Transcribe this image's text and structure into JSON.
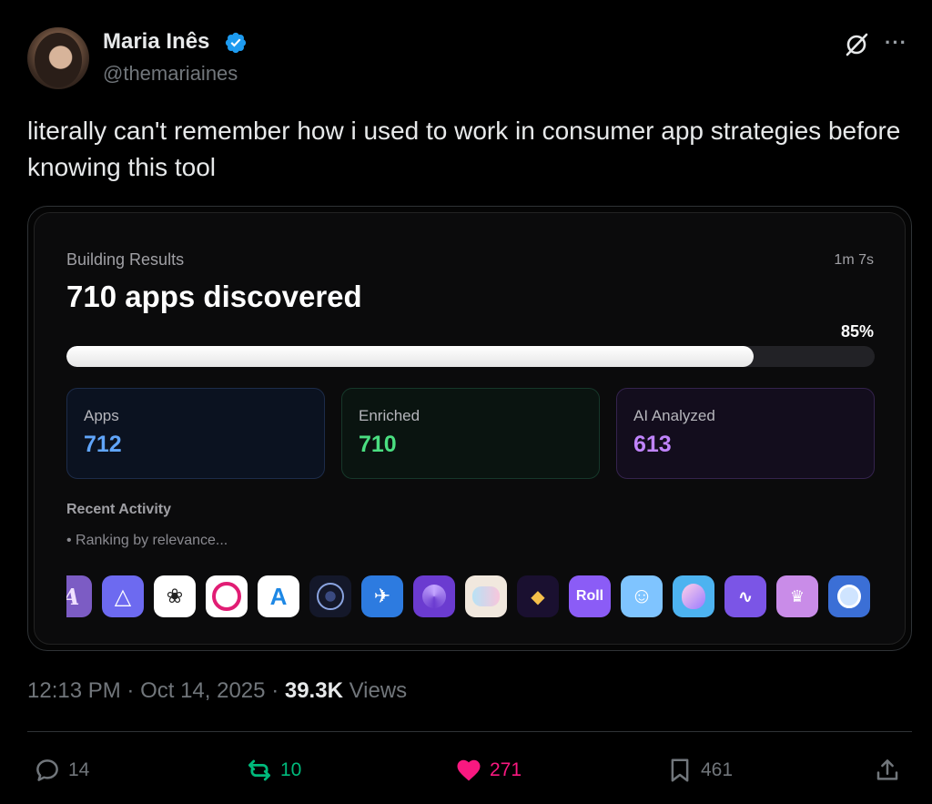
{
  "author": {
    "name": "Maria Inês",
    "handle": "@themariaines",
    "verified": true
  },
  "tweet": {
    "text": "literally can't remember how i used to work in consumer app strategies before knowing this tool"
  },
  "card": {
    "label": "Building Results",
    "elapsed": "1m 7s",
    "headline": "710 apps discovered",
    "progress_percent": "85%",
    "progress_value": 0.85,
    "stats": [
      {
        "label": "Apps",
        "value": "712",
        "color": "#60a5fa"
      },
      {
        "label": "Enriched",
        "value": "710",
        "color": "#4ade80"
      },
      {
        "label": "AI Analyzed",
        "value": "613",
        "color": "#c084fc"
      }
    ],
    "activity_title": "Recent Activity",
    "activity_line": "• Ranking by relevance...",
    "app_icons": [
      {
        "name": "script-a-app-icon",
        "text": "A",
        "bg": "#7c5cc4"
      },
      {
        "name": "triangle-app-icon",
        "text": "",
        "bg": "#6d6af0"
      },
      {
        "name": "meditation-app-icon",
        "text": "",
        "bg": "#ffffff"
      },
      {
        "name": "ring-app-icon",
        "text": "",
        "bg": "#ffffff"
      },
      {
        "name": "app-store-icon",
        "text": "",
        "bg": "#ffffff"
      },
      {
        "name": "flower-of-life-app-icon",
        "text": "",
        "bg": "#14182a"
      },
      {
        "name": "bird-app-icon",
        "text": "",
        "bg": "#2d7be0"
      },
      {
        "name": "swirl-app-icon",
        "text": "",
        "bg": "#6b3bd0"
      },
      {
        "name": "pastel-characters-app-icon",
        "text": "",
        "bg": "#f1e8de"
      },
      {
        "name": "black-cat-app-icon",
        "text": "",
        "bg": "#1a1030"
      },
      {
        "name": "roll-app-icon",
        "text": "Roll",
        "bg": "#8b5cf6"
      },
      {
        "name": "smiley-app-icon",
        "text": "",
        "bg": "#7fc4ff"
      },
      {
        "name": "face-profile-app-icon",
        "text": "",
        "bg": "#4db3f0"
      },
      {
        "name": "waveform-app-icon",
        "text": "",
        "bg": "#7b55e6"
      },
      {
        "name": "crown-camera-app-icon",
        "text": "",
        "bg": "#c98ce8"
      },
      {
        "name": "astronaut-app-icon",
        "text": "",
        "bg": "#3b6fd6"
      },
      {
        "name": "partial-app-icon",
        "text": "",
        "bg": "#1a1a1a"
      }
    ]
  },
  "meta": {
    "time": "12:13 PM",
    "date": "Oct 14, 2025",
    "views_count": "39.3K",
    "views_label": "Views"
  },
  "actions": {
    "replies": "14",
    "reposts": "10",
    "likes": "271",
    "bookmarks": "461"
  },
  "colors": {
    "verified": "#1d9bf0",
    "repost": "#00ba7c",
    "like": "#f91880",
    "muted": "#71767b"
  }
}
